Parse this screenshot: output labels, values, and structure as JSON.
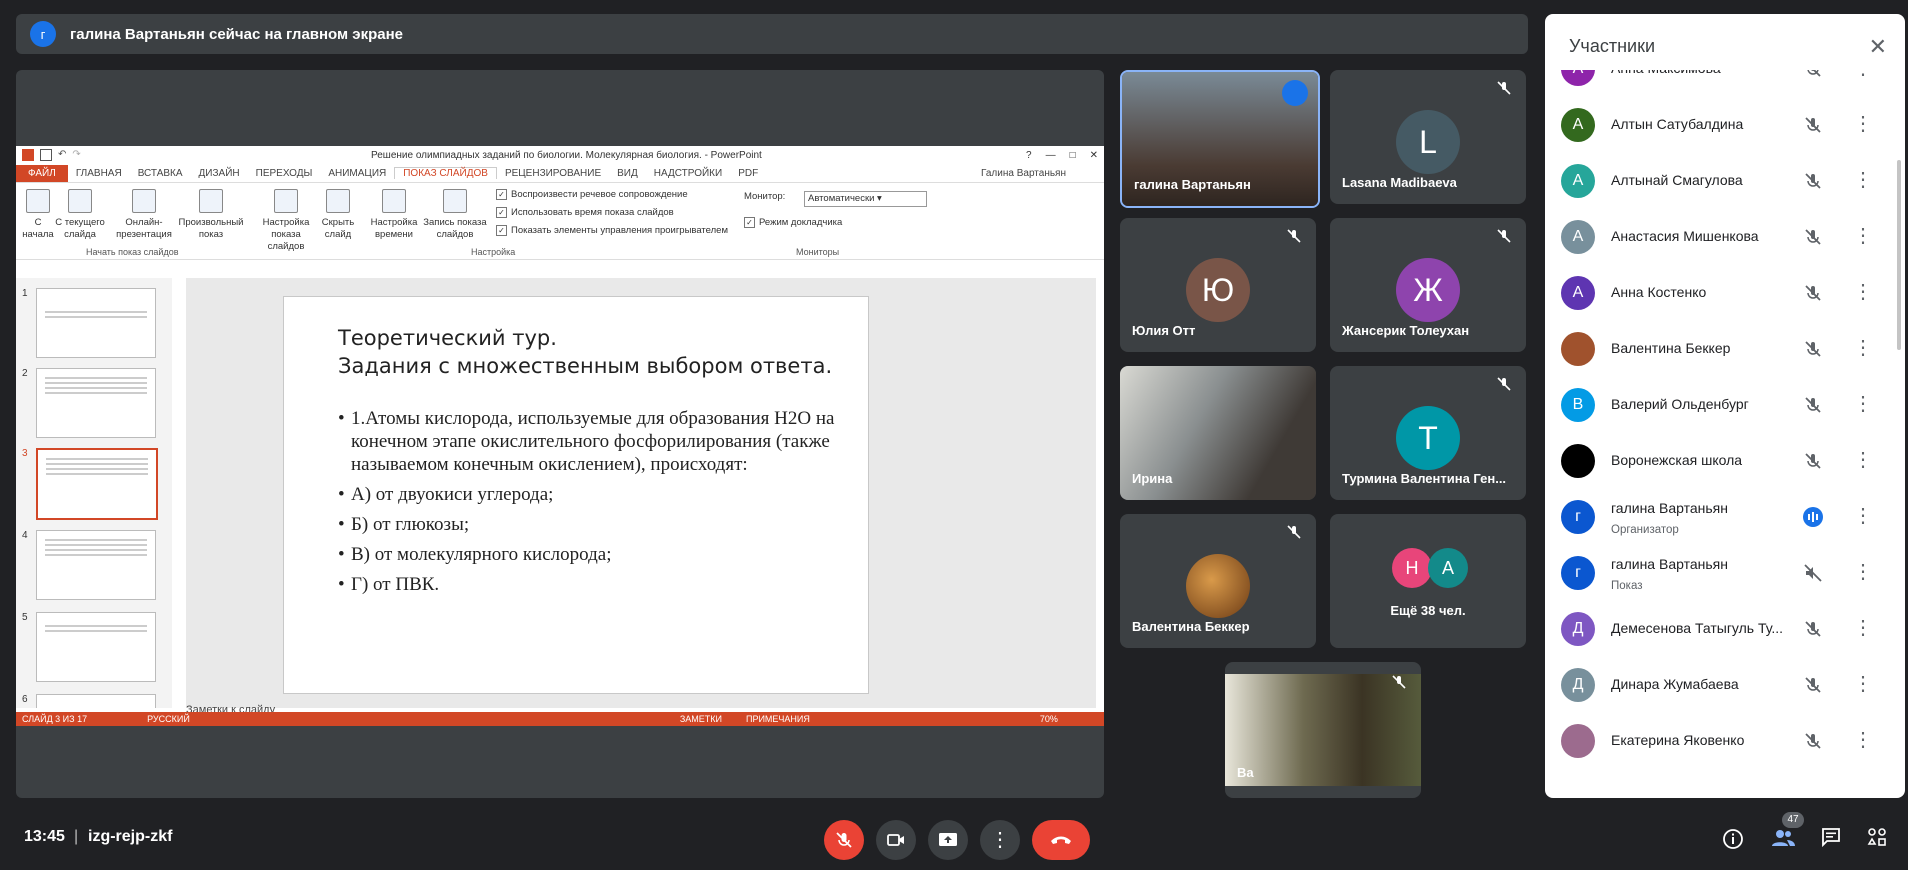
{
  "banner": {
    "avatar_letter": "г",
    "text": "галина Вартаньян сейчас на главном экране"
  },
  "ppt": {
    "window_title": "Решение олимпиадных заданий по биологии. Молекулярная биология. - PowerPoint",
    "user": "Галина Вартаньян",
    "tabs": [
      "ФАЙЛ",
      "ГЛАВНАЯ",
      "ВСТАВКА",
      "ДИЗАЙН",
      "ПЕРЕХОДЫ",
      "АНИМАЦИЯ",
      "ПОКАЗ СЛАЙДОВ",
      "РЕЦЕНЗИРОВАНИЕ",
      "ВИД",
      "НАДСТРОЙКИ",
      "PDF"
    ],
    "ribbon": {
      "btn_from_start": "С начала",
      "btn_from_current": "С текущего слайда",
      "btn_online": "Онлайн-презентация",
      "btn_custom": "Произвольный показ",
      "btn_setup": "Настройка показа слайдов",
      "btn_hide": "Скрыть слайд",
      "btn_timing": "Настройка времени",
      "btn_record": "Запись показа слайдов",
      "chk_narration": "Воспроизвести речевое сопровождение",
      "chk_timings": "Использовать время показа слайдов",
      "chk_controls": "Показать элементы управления проигрывателем",
      "monitor_label": "Монитор:",
      "monitor_value": "Автоматически",
      "chk_presenter": "Режим докладчика",
      "group_start": "Начать показ слайдов",
      "group_setup": "Настройка",
      "group_monitors": "Мониторы"
    },
    "thumbnails": [
      "1",
      "2",
      "3",
      "4",
      "5",
      "6"
    ],
    "slide": {
      "title_line1": "Теоретический тур.",
      "title_line2": "Задания с множественным выбором ответа.",
      "bullets": [
        "1.Атомы кислорода, используемые для образования H2O на конечном этапе окислительного фосфорилирования  (также называемом конечным окислением), происходят:",
        "А) от двуокиси углерода;",
        "Б) от глюкозы;",
        "В) от молекулярного кислорода;",
        "Г) от ПВК."
      ]
    },
    "notes_placeholder": "Заметки к слайду",
    "status": {
      "slide": "СЛАЙД 3 ИЗ 17",
      "lang": "РУССКИЙ",
      "notes": "ЗАМЕТКИ",
      "comments": "ПРИМЕЧАНИЯ",
      "zoom": "70%"
    }
  },
  "tiles": [
    {
      "name": "галина Вартаньян",
      "letter": "",
      "color": "#6d4c41"
    },
    {
      "name": "Lasana Madibaeva",
      "letter": "L",
      "color": "#455a64"
    },
    {
      "name": "Юлия Отт",
      "letter": "Ю",
      "color": "#795548"
    },
    {
      "name": "Жансерик Толеухан",
      "letter": "Ж",
      "color": "#8e44ad"
    },
    {
      "name": "Ирина",
      "letter": "",
      "color": "#5d6b70"
    },
    {
      "name": "Турмина Валентина Ген...",
      "letter": "T",
      "color": "#0097a7"
    },
    {
      "name": "Валентина Беккер",
      "letter": "",
      "color": "#8d5524"
    },
    {
      "name": "Ещё 38 чел.",
      "letter1": "Н",
      "letter2": "А",
      "color1": "#e8457a",
      "color2": "#138a8a"
    },
    {
      "name": "Ва",
      "letter": "",
      "color": "#5a5a48"
    }
  ],
  "panel": {
    "title": "Участники",
    "people": [
      {
        "name": "Анна Максимова",
        "letter": "А",
        "color": "#8e24aa",
        "role": ""
      },
      {
        "name": "Алтын Сатубалдина",
        "letter": "А",
        "color": "#33691e",
        "role": ""
      },
      {
        "name": "Алтынай Смагулова",
        "letter": "А",
        "color": "#26a69a",
        "role": ""
      },
      {
        "name": "Анастасия Мишенкова",
        "letter": "А",
        "color": "#78909c",
        "role": ""
      },
      {
        "name": "Анна Костенко",
        "letter": "А",
        "color": "#5e35b1",
        "role": ""
      },
      {
        "name": "Валентина Беккер",
        "letter": "",
        "color": "#a0522d",
        "role": ""
      },
      {
        "name": "Валерий Ольденбург",
        "letter": "В",
        "color": "#039be5",
        "role": ""
      },
      {
        "name": "Воронежская школа",
        "letter": "",
        "color": "#000000",
        "role": ""
      },
      {
        "name": "галина Вартаньян",
        "letter": "г",
        "color": "#0b57d0",
        "role": "Организатор"
      },
      {
        "name": "галина Вартаньян",
        "letter": "г",
        "color": "#0b57d0",
        "role": "Показ"
      },
      {
        "name": "Демесенова Татыгуль Ту...",
        "letter": "Д",
        "color": "#7e57c2",
        "role": ""
      },
      {
        "name": "Динара Жумабаева",
        "letter": "Д",
        "color": "#78909c",
        "role": ""
      },
      {
        "name": "Екатерина Яковенко",
        "letter": "",
        "color": "#9c6b8e",
        "role": ""
      }
    ]
  },
  "bottom": {
    "time": "13:45",
    "separator": "|",
    "meeting_code": "izg-rejp-zkf",
    "participants_badge": "47"
  },
  "colors": {
    "bg": "#202124",
    "danger": "#ea4335",
    "accent": "#8ab4f8",
    "ppt_orange": "#d24726"
  }
}
